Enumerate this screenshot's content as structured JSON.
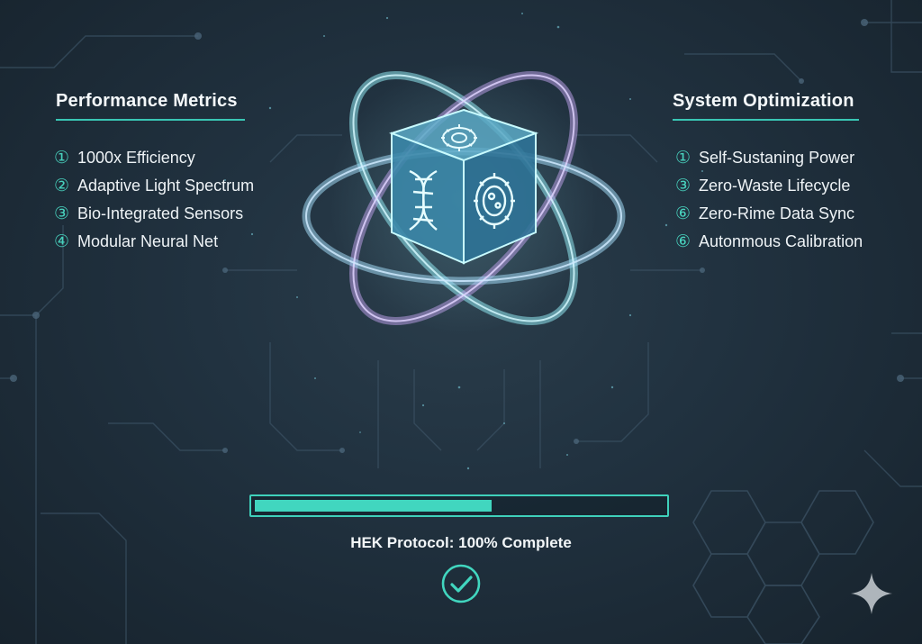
{
  "left_panel": {
    "title": "Performance Metrics",
    "items": [
      {
        "num": "①",
        "label": "1000x Efficiency"
      },
      {
        "num": "②",
        "label": "Adaptive Light Spectrum"
      },
      {
        "num": "③",
        "label": "Bio-Integrated Sensors"
      },
      {
        "num": "④",
        "label": "Modular Neural Net"
      }
    ]
  },
  "right_panel": {
    "title": "System Optimization",
    "items": [
      {
        "num": "①",
        "label": "Self-Sustaning Power"
      },
      {
        "num": "③",
        "label": "Zero-Waste Lifecycle"
      },
      {
        "num": "⑥",
        "label": "Zero-Rime Data Sync"
      },
      {
        "num": "⑥",
        "label": "Autonmous Calibration"
      }
    ]
  },
  "progress": {
    "fill_fraction": 0.58,
    "status_text": "HEK Protocol: 100% Complete"
  },
  "icons": {
    "check": "check-circle-icon",
    "sparkle": "sparkle-icon",
    "dna": "dna-icon",
    "gear": "gear-icon",
    "cell": "cell-gear-icon"
  },
  "colors": {
    "accent": "#41d6bf",
    "background": "#1b2a36",
    "ring_cyan": "#8fe6ef",
    "ring_violet": "#b59be0"
  }
}
